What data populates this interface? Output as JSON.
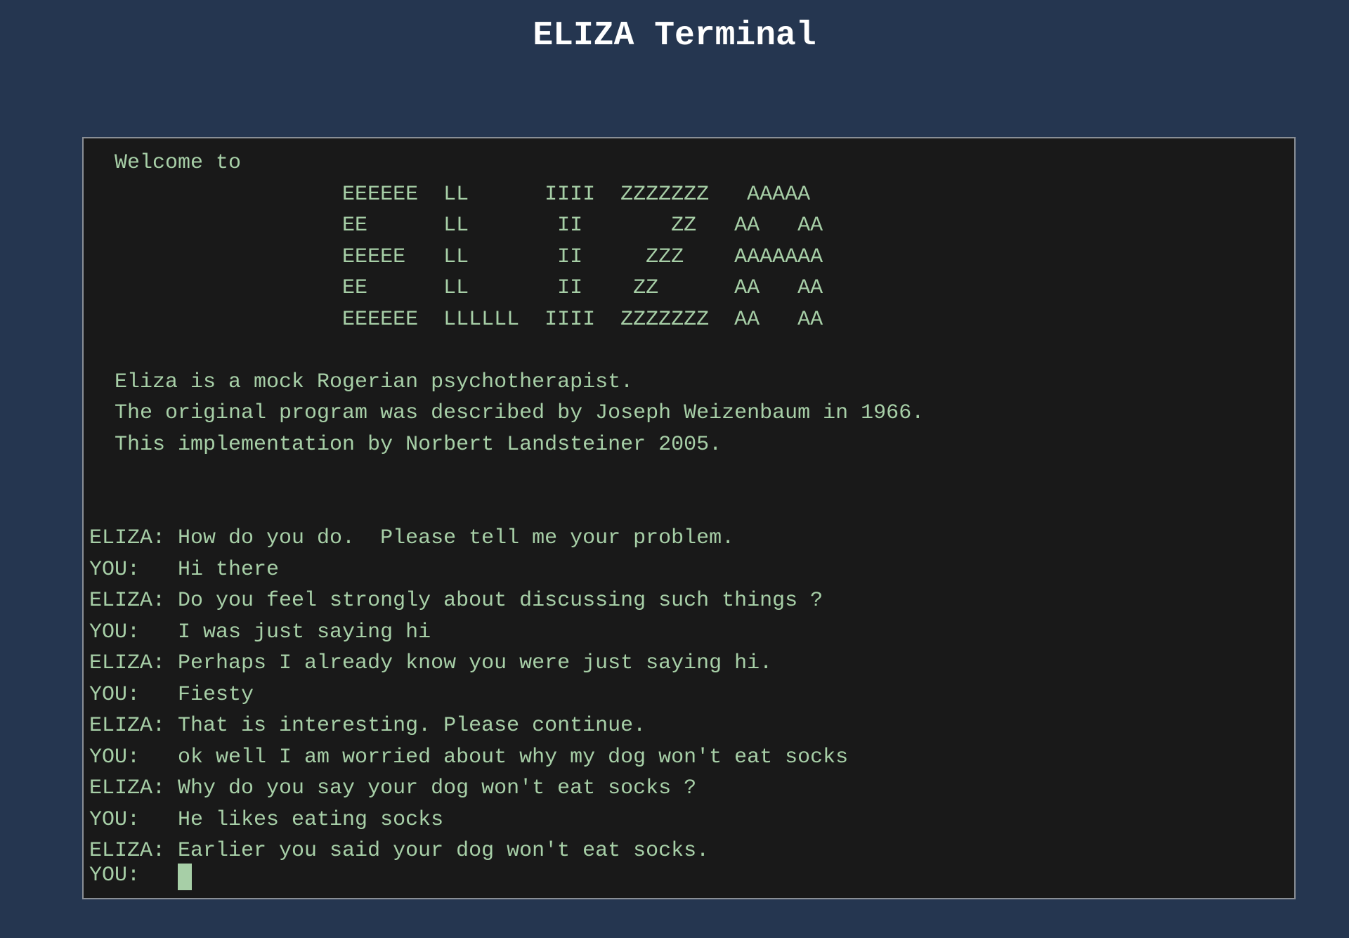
{
  "page": {
    "title": "ELIZA Terminal"
  },
  "terminal": {
    "banner": "  Welcome to\n                    EEEEEE  LL      IIII  ZZZZZZZ   AAAAA\n                    EE      LL       II       ZZ   AA   AA\n                    EEEEE   LL       II     ZZZ    AAAAAAA\n                    EE      LL       II    ZZ      AA   AA\n                    EEEEEE  LLLLLL  IIII  ZZZZZZZ  AA   AA\n\n  Eliza is a mock Rogerian psychotherapist.\n  The original program was described by Joseph Weizenbaum in 1966.\n  This implementation by Norbert Landsteiner 2005.\n\n\n",
    "transcript": [
      "ELIZA: How do you do.  Please tell me your problem.",
      "YOU:   Hi there",
      "ELIZA: Do you feel strongly about discussing such things ?",
      "YOU:   I was just saying hi",
      "ELIZA: Perhaps I already know you were just saying hi.",
      "YOU:   Fiesty",
      "ELIZA: That is interesting. Please continue.",
      "YOU:   ok well I am worried about why my dog won't eat socks",
      "ELIZA: Why do you say your dog won't eat socks ?",
      "YOU:   He likes eating socks",
      "ELIZA: Earlier you said your dog won't eat socks."
    ],
    "prompt": "YOU:   ",
    "input_value": ""
  },
  "colors": {
    "page_background": "#253650",
    "terminal_background": "#191919",
    "terminal_text": "#a7cfa7",
    "title_text": "#ffffff"
  }
}
